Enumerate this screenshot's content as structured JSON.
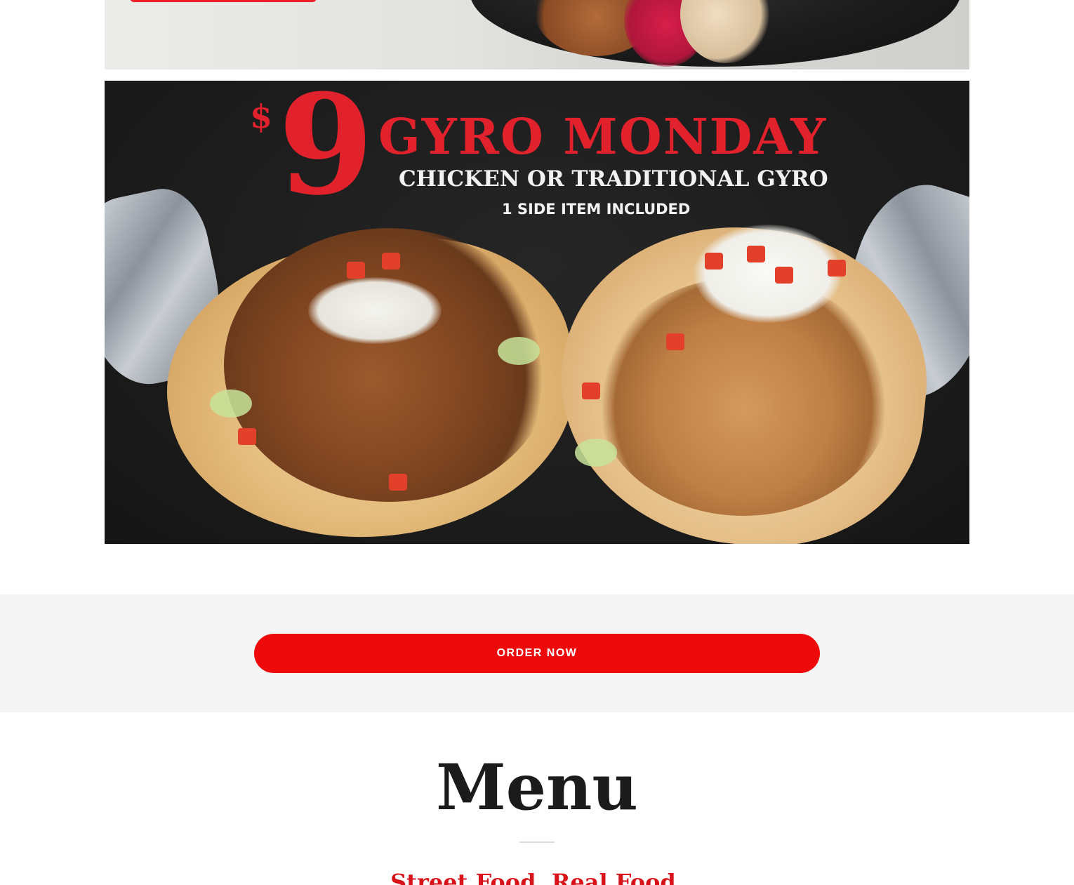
{
  "banner": {
    "dollar_sign": "$",
    "price_number": "9",
    "headline": "GYRO MONDAY",
    "subheadline": "CHICKEN OR TRADITIONAL GYRO",
    "side_note": "1 SIDE ITEM INCLUDED"
  },
  "order_section": {
    "button_label": "ORDER NOW"
  },
  "menu_section": {
    "title": "Menu",
    "subtitle": "Street Food. Real Food."
  },
  "colors": {
    "accent_red": "#ee0a0a",
    "banner_red": "#e1212b",
    "section_gray": "#f5f5f5",
    "heading_dark": "#1b1b1b"
  }
}
